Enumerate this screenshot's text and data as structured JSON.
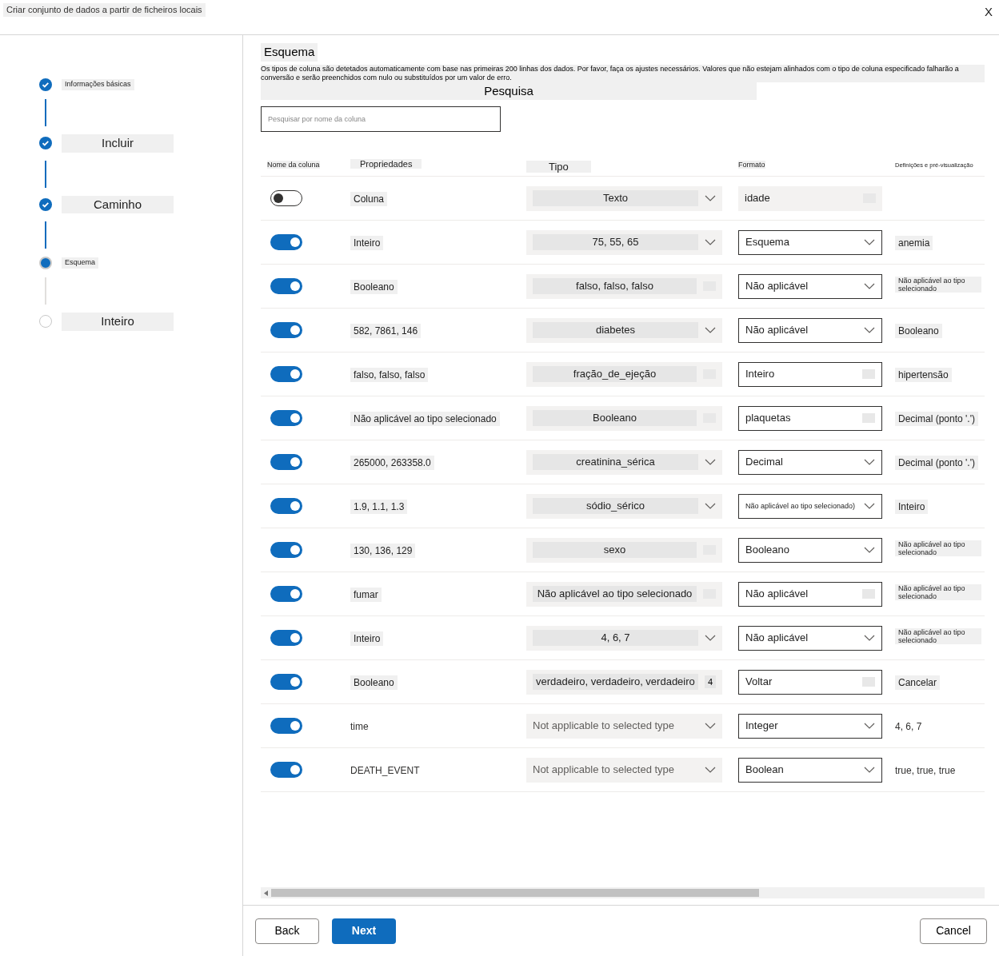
{
  "window": {
    "title": "Criar conjunto de dados a partir de ficheiros locais",
    "close": "X"
  },
  "steps": [
    {
      "label": "Informações básicas",
      "done": true,
      "current": false,
      "small": true
    },
    {
      "label": "Incluir",
      "done": true,
      "current": false,
      "small": false
    },
    {
      "label": "Caminho",
      "done": true,
      "current": false,
      "small": false
    },
    {
      "label": "Esquema",
      "done": false,
      "current": true,
      "small": true
    },
    {
      "label": "Inteiro",
      "done": false,
      "current": false,
      "small": false
    }
  ],
  "section": {
    "title": "Esquema",
    "description": "Os tipos de coluna são detetados automaticamente com base nas primeiras 200 linhas dos dados. Por favor, faça os ajustes necessários. Valores que não estejam alinhados com o tipo de coluna especificado falharão a conversão e serão preenchidos com nulo ou substituídos por um valor de erro.",
    "search_label": "Pesquisa"
  },
  "search": {
    "placeholder": "Pesquisar por nome da coluna"
  },
  "table": {
    "columns": [
      "Nome da coluna",
      "Propriedades",
      "Tipo",
      "Formato",
      "Definições e pré-visualização"
    ],
    "rows": [
      {
        "kind": "translated",
        "on": false,
        "property": "Coluna",
        "type": "Texto",
        "type_chevron": true,
        "format": "idade",
        "format_select": false
      },
      {
        "kind": "translated",
        "on": true,
        "property": "Inteiro",
        "type": "75, 55, 65",
        "type_chevron": true,
        "format": "Esquema",
        "format_select": true,
        "preview": "anemia"
      },
      {
        "kind": "translated",
        "on": true,
        "property": "Booleano",
        "type": "falso, falso, falso",
        "type_chevron": false,
        "format": "Não aplicável",
        "format_select": true,
        "preview": "Não aplicável ao tipo selecionado"
      },
      {
        "kind": "translated",
        "on": true,
        "property": "582, 7861, 146",
        "type": "diabetes",
        "type_chevron": true,
        "format": "Não aplicável",
        "format_select": true,
        "preview": "Booleano"
      },
      {
        "kind": "translated",
        "on": true,
        "property": "falso, falso, falso",
        "type": "fração_de_ejeção",
        "type_chevron": false,
        "format": "Inteiro",
        "format_select": false,
        "preview": "hipertensão"
      },
      {
        "kind": "translated",
        "on": true,
        "property": "Não aplicável ao tipo selecionado",
        "type": "Booleano",
        "type_chevron": false,
        "format": "plaquetas",
        "format_select": false,
        "preview": "Decimal (ponto '.')"
      },
      {
        "kind": "translated",
        "on": true,
        "property": "265000, 263358.0",
        "type": "creatinina_sérica",
        "type_chevron": true,
        "format": "Decimal",
        "format_select": true,
        "preview": "Decimal (ponto '.')"
      },
      {
        "kind": "translated",
        "on": true,
        "property": "1.9, 1.1, 1.3",
        "type": "sódio_sérico",
        "type_chevron": true,
        "format": "Não aplicável ao tipo selecionado)",
        "format_select": true,
        "preview": "Inteiro"
      },
      {
        "kind": "translated",
        "on": true,
        "property": "130, 136, 129",
        "type": "sexo",
        "type_chevron": false,
        "format": "Booleano",
        "format_select": true,
        "preview": "Não aplicável ao tipo selecionado"
      },
      {
        "kind": "translated",
        "on": true,
        "property": "fumar",
        "type": "Não aplicável ao tipo selecionado",
        "type_chevron": false,
        "format": "Não aplicável",
        "format_select": false,
        "preview": "Não aplicável ao tipo selecionado"
      },
      {
        "kind": "translated",
        "on": true,
        "property": "Inteiro",
        "type": "4, 6, 7",
        "type_chevron": true,
        "format": "Não aplicável",
        "format_select": true,
        "preview": "Não aplicável ao tipo selecionado"
      },
      {
        "kind": "translated",
        "on": true,
        "property": "Booleano",
        "type": "verdadeiro, verdadeiro, verdadeiro",
        "type_badge": "4",
        "type_chevron": false,
        "format": "Voltar",
        "format_select": false,
        "preview": "Cancelar"
      },
      {
        "kind": "native",
        "on": true,
        "property": "time",
        "type": "Not applicable to selected type",
        "type_chevron": true,
        "format": "Integer",
        "format_select": true,
        "preview": "4, 6, 7"
      },
      {
        "kind": "native",
        "on": true,
        "property": "DEATH_EVENT",
        "type": "Not applicable to selected type",
        "type_chevron": true,
        "format": "Boolean",
        "format_select": true,
        "preview": "true, true, true"
      }
    ]
  },
  "footer": {
    "back": "Back",
    "next": "Next",
    "cancel": "Cancel"
  }
}
